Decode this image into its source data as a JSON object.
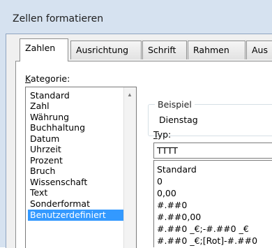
{
  "window": {
    "title": "Zellen formatieren"
  },
  "tabs": [
    {
      "label": "Zahlen",
      "active": true
    },
    {
      "label": "Ausrichtung",
      "active": false
    },
    {
      "label": "Schrift",
      "active": false
    },
    {
      "label": "Rahmen",
      "active": false
    },
    {
      "label": "Aus",
      "active": false
    }
  ],
  "category": {
    "label_underlined": "K",
    "label_rest": "ategorie:",
    "items": [
      "Standard",
      "Zahl",
      "Währung",
      "Buchhaltung",
      "Datum",
      "Uhrzeit",
      "Prozent",
      "Bruch",
      "Wissenschaft",
      "Text",
      "Sonderformat",
      "Benutzerdefiniert"
    ],
    "selected_index": 11
  },
  "sample": {
    "legend": "Beispiel",
    "value": "Dienstag"
  },
  "type": {
    "label_underlined": "T",
    "label_rest": "yp:",
    "value": "TTTT",
    "formats": [
      "Standard",
      "0",
      "0,00",
      "#.##0",
      "#.##0,00",
      "#.##0 _€;-#.##0 _€",
      "#.##0 _€;[Rot]-#.##0"
    ]
  },
  "colors": {
    "selection": "#3399ff",
    "frame": "#d6e2f0",
    "dialog_bg": "#f0f0f0"
  }
}
